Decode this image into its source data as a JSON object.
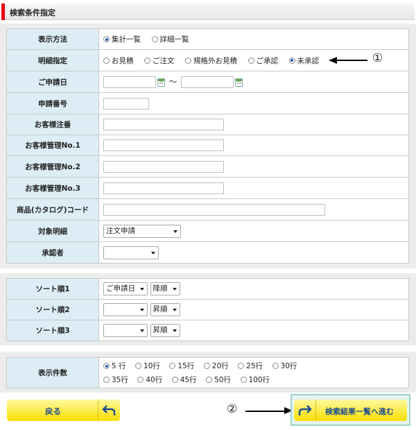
{
  "header": {
    "title": "検索条件指定"
  },
  "labels": {
    "display_method": "表示方法",
    "detail_spec": "明細指定",
    "apply_date": "ご申請日",
    "apply_no": "申請番号",
    "customer_order": "お客様注番",
    "mgmt1": "お客様管理No.1",
    "mgmt2": "お客様管理No.2",
    "mgmt3": "お客様管理No.3",
    "product_code": "商品(カタログ)コード",
    "target_detail": "対象明細",
    "approver": "承認者",
    "sort1": "ソート順1",
    "sort2": "ソート順2",
    "sort3": "ソート順3",
    "count": "表示件数"
  },
  "display_method": {
    "options": [
      "集計一覧",
      "詳細一覧"
    ],
    "selected": "集計一覧"
  },
  "detail_spec": {
    "options": [
      "お見積",
      "ご注文",
      "規格外お見積",
      "ご承認",
      "未承認"
    ],
    "selected": "未承認"
  },
  "date_separator": "～",
  "calendar_glyph": "21",
  "target_detail_value": "注文申請",
  "approver_value": "",
  "sorts": [
    {
      "field": "ご申請日",
      "order": "降順"
    },
    {
      "field": "",
      "order": "昇順"
    },
    {
      "field": "",
      "order": "昇順"
    }
  ],
  "count": {
    "row1": [
      "5 行",
      "10行",
      "15行",
      "20行",
      "25行",
      "30行"
    ],
    "row2": [
      "35行",
      "40行",
      "45行",
      "50行",
      "100行"
    ],
    "selected": "5 行"
  },
  "buttons": {
    "back": "戻る",
    "next": "検索結果一覧へ進む"
  },
  "annotations": {
    "one": "①",
    "two": "②"
  },
  "colors": {
    "accent_red": "#e60012",
    "label_bg": "#dcedf5",
    "button_yellow": "#f8df00",
    "highlight": "#9cd3c9"
  }
}
